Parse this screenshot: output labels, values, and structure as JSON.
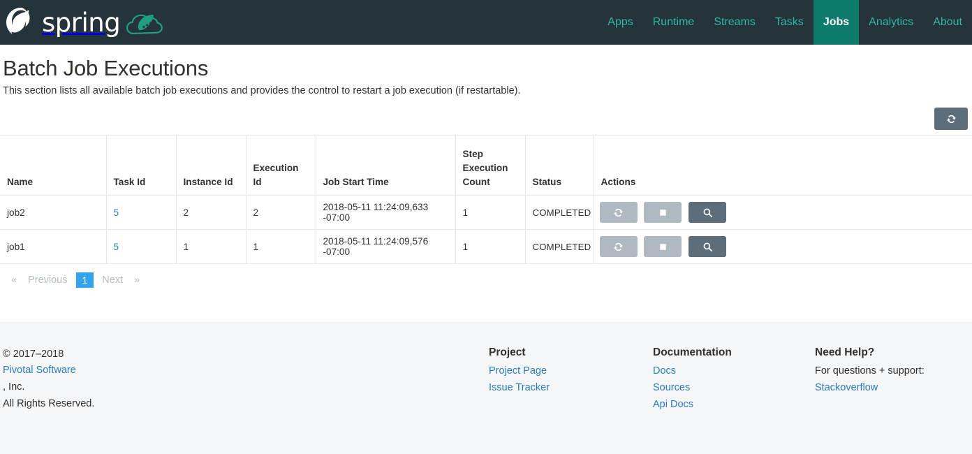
{
  "header": {
    "brand_word": "spring",
    "logo_icon": "spring-leaf-logo",
    "cloud_icon": "spring-cloud-badge",
    "nav": [
      {
        "label": "Apps",
        "active": false
      },
      {
        "label": "Runtime",
        "active": false
      },
      {
        "label": "Streams",
        "active": false
      },
      {
        "label": "Tasks",
        "active": false
      },
      {
        "label": "Jobs",
        "active": true
      },
      {
        "label": "Analytics",
        "active": false
      },
      {
        "label": "About",
        "active": false
      }
    ],
    "accent_color": "#2eb8a0",
    "active_bg": "#0d7b6c",
    "bar_bg": "#25333b"
  },
  "page": {
    "title": "Batch Job Executions",
    "description": "This section lists all available batch job executions and provides the control to restart a job execution (if restartable)."
  },
  "toolbar": {
    "refresh_icon": "refresh-icon",
    "refresh_label": ""
  },
  "table": {
    "columns": [
      "Name",
      "Task Id",
      "Instance Id",
      "Execution Id",
      "Job Start Time",
      "Step Execution Count",
      "Status",
      "Actions"
    ],
    "rows": [
      {
        "name": "job2",
        "task_id": "5",
        "instance_id": "2",
        "execution_id": "2",
        "job_start_time": "2018-05-11 11:24:09,633 -07:00",
        "step_execution_count": "1",
        "status": "COMPLETED"
      },
      {
        "name": "job1",
        "task_id": "5",
        "instance_id": "1",
        "execution_id": "1",
        "job_start_time": "2018-05-11 11:24:09,576 -07:00",
        "step_execution_count": "1",
        "status": "COMPLETED"
      }
    ],
    "actions": {
      "restart_icon": "restart-icon",
      "stop_icon": "stop-icon",
      "details_icon": "magnifier-icon"
    },
    "status_color": "#5f8c3e",
    "link_color": "#2b7bba"
  },
  "pagination": {
    "prev_symbol": "«",
    "prev_label": "Previous",
    "pages": [
      "1"
    ],
    "current_page": "1",
    "next_label": "Next",
    "next_symbol": "»",
    "active_color": "#33a3ec"
  },
  "footer": {
    "copyright": "© 2017–2018 ",
    "company_link": "Pivotal Software",
    "copyright_tail": ", Inc.",
    "rights": "All Rights Reserved.",
    "columns": [
      {
        "heading": "Project",
        "links": [
          "Project Page",
          "Issue Tracker"
        ]
      },
      {
        "heading": "Documentation",
        "links": [
          "Docs",
          "Sources",
          "Api Docs"
        ]
      }
    ],
    "help": {
      "heading": "Need Help?",
      "text": "For questions + support:",
      "link": "Stackoverflow"
    },
    "bg_color": "#f4f6f8"
  }
}
